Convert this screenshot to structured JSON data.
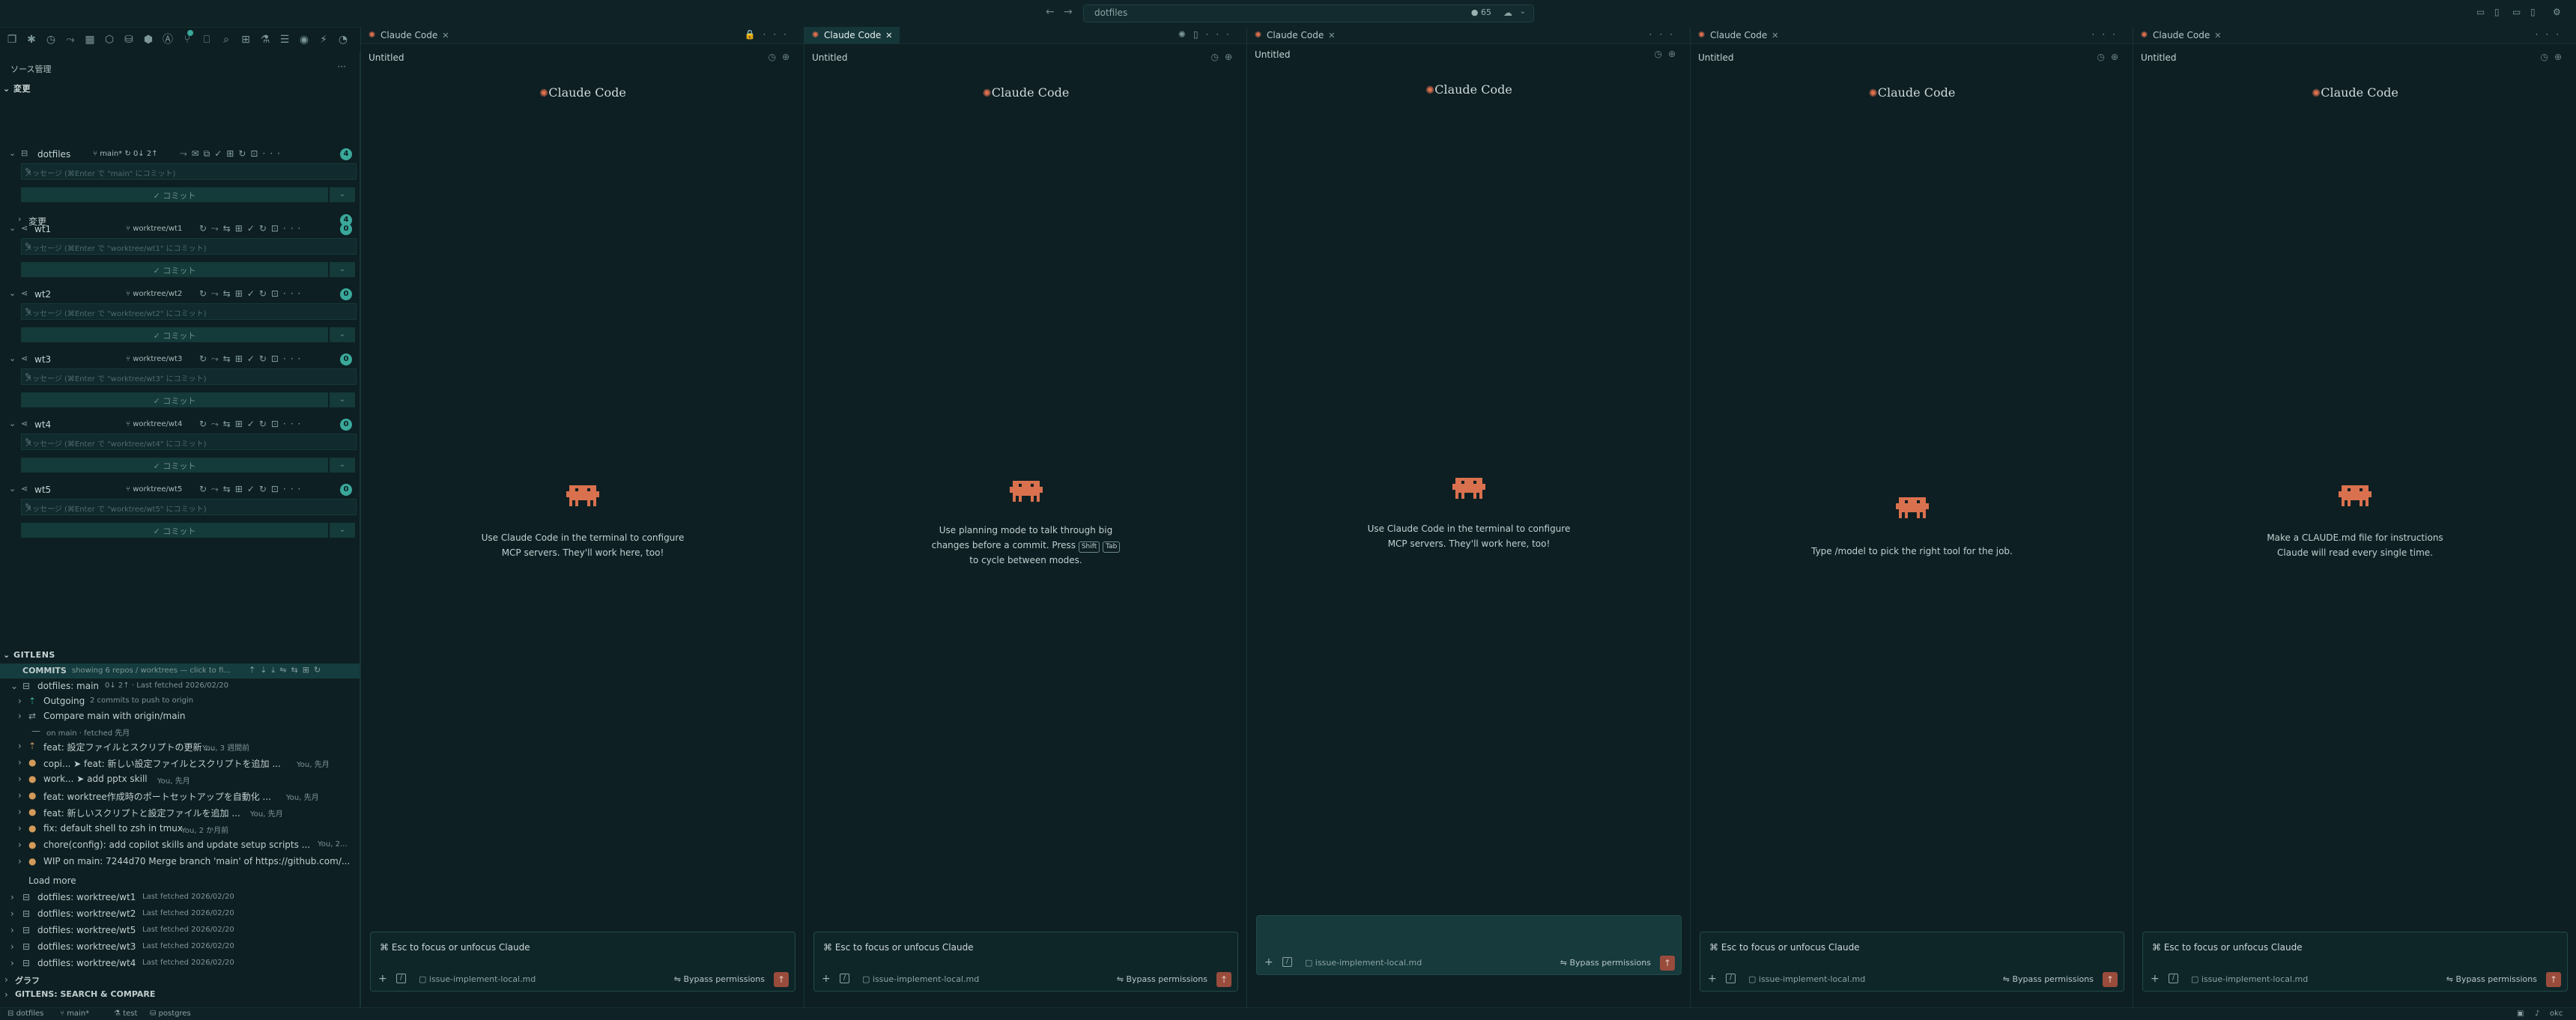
{
  "title_bar": {
    "search_text": "dotfiles",
    "badge_count": "65"
  },
  "sidebar": {
    "header": "ソース管理",
    "changes_section": "変更",
    "repos": [
      {
        "name": "dotfiles",
        "branch": "main*",
        "sync": "0↓ 2↑",
        "message_placeholder": "メッセージ (⌘Enter で \"main\" にコミット)",
        "commit_label": "✓ コミット",
        "count": "4"
      },
      {
        "name": "wt1",
        "branch": "worktree/wt1",
        "message_placeholder": "メッセージ (⌘Enter で \"worktree/wt1\" にコミット)",
        "commit_label": "✓ コミット",
        "count": "0"
      },
      {
        "name": "wt2",
        "branch": "worktree/wt2",
        "message_placeholder": "メッセージ (⌘Enter で \"worktree/wt2\" にコミット)",
        "commit_label": "✓ コミット",
        "count": "0"
      },
      {
        "name": "wt3",
        "branch": "worktree/wt3",
        "message_placeholder": "メッセージ (⌘Enter で \"worktree/wt3\" にコミット)",
        "commit_label": "✓ コミット",
        "count": "0"
      },
      {
        "name": "wt4",
        "branch": "worktree/wt4",
        "message_placeholder": "メッセージ (⌘Enter で \"worktree/wt4\" にコミット)",
        "commit_label": "✓ コミット",
        "count": "0"
      },
      {
        "name": "wt5",
        "branch": "worktree/wt5",
        "message_placeholder": "メッセージ (⌘Enter で \"worktree/wt5\" にコミット)",
        "commit_label": "✓ コミット",
        "count": "0"
      }
    ],
    "changes_row": {
      "label": "変更",
      "count": "4"
    },
    "gitlens": {
      "header": "GITLENS",
      "commits_label": "COMMITS",
      "commits_sub": "showing 6 repos / worktrees — click to fi...",
      "repo_main": "dotfiles: main",
      "repo_main_sub": "0↓ 2↑ · Last fetched 2026/02/20",
      "outgoing": "Outgoing",
      "outgoing_sub": "2 commits to push to origin",
      "compare": "Compare main with origin/main",
      "on_main": "on main · fetched 先月",
      "commits": [
        {
          "msg": "feat: 設定ファイルとスクリプトの更新 ...",
          "meta": "You, 3 週間前"
        },
        {
          "msg": "copi... ➤ feat: 新しい設定ファイルとスクリプトを追加 ...",
          "meta": "You, 先月"
        },
        {
          "msg": "work... ➤ add pptx skill",
          "meta": "You, 先月"
        },
        {
          "msg": "feat: worktree作成時のポートセットアップを自動化 ...",
          "meta": "You, 先月"
        },
        {
          "msg": "feat: 新しいスクリプトと設定ファイルを追加 ...",
          "meta": "You, 先月"
        },
        {
          "msg": "fix: default shell to zsh in tmux",
          "meta": "You, 2 か月前"
        },
        {
          "msg": "chore(config): add copilot skills and update setup scripts ...",
          "meta": "You, 2..."
        },
        {
          "msg": "WIP on main: 7244d70 Merge branch 'main' of https://github.com/...",
          "meta": ""
        }
      ],
      "load_more": "Load more",
      "worktrees": [
        {
          "name": "dotfiles: worktree/wt1",
          "sub": "Last fetched 2026/02/20"
        },
        {
          "name": "dotfiles: worktree/wt2",
          "sub": "Last fetched 2026/02/20"
        },
        {
          "name": "dotfiles: worktree/wt5",
          "sub": "Last fetched 2026/02/20"
        },
        {
          "name": "dotfiles: worktree/wt3",
          "sub": "Last fetched 2026/02/20"
        },
        {
          "name": "dotfiles: worktree/wt4",
          "sub": "Last fetched 2026/02/20"
        }
      ],
      "graph": "グラフ",
      "search_compare": "GITLENS: SEARCH & COMPARE"
    }
  },
  "editor_groups": [
    {
      "tab": "Claude Code",
      "subtitle": "Untitled",
      "brand": "Claude Code",
      "tip_lines": [
        "Use Claude Code in the terminal to configure",
        "MCP servers. They'll work here, too!"
      ],
      "input_placeholder": "⌘ Esc to focus or unfocus Claude",
      "file": "issue-implement-local.md",
      "bypass": "Bypass permissions"
    },
    {
      "tab": "Claude Code",
      "subtitle": "Untitled",
      "brand": "Claude Code",
      "tip_lines": [
        "Use planning mode to talk through big",
        "changes before a commit. Press",
        "to cycle between modes."
      ],
      "kbd": [
        "Shift",
        "Tab"
      ],
      "input_placeholder": "⌘ Esc to focus or unfocus Claude",
      "file": "issue-implement-local.md",
      "bypass": "Bypass permissions"
    },
    {
      "tab": "Claude Code",
      "subtitle": "Untitled",
      "brand": "Claude Code",
      "tip_lines": [
        "Use Claude Code in the terminal to configure",
        "MCP servers. They'll work here, too!"
      ],
      "input_placeholder": "",
      "file": "issue-implement-local.md",
      "bypass": "Bypass permissions"
    },
    {
      "tab": "Claude Code",
      "subtitle": "Untitled",
      "brand": "Claude Code",
      "tip_lines": [
        "Type /model to pick the right tool for the job."
      ],
      "input_placeholder": "⌘ Esc to focus or unfocus Claude",
      "file": "issue-implement-local.md",
      "bypass": "Bypass permissions"
    },
    {
      "tab": "Claude Code",
      "subtitle": "Untitled",
      "brand": "Claude Code",
      "tip_lines": [
        "Make a CLAUDE.md file for instructions",
        "Claude will read every single time."
      ],
      "input_placeholder": "⌘ Esc to focus or unfocus Claude",
      "file": "issue-implement-local.md",
      "bypass": "Bypass permissions"
    }
  ],
  "status_bar": {
    "repo": "dotfiles",
    "branch": "main*",
    "test": "test",
    "db": "postgres",
    "right": "okc"
  },
  "colors": {
    "background": "#0d1f22",
    "accent": "#3aa89a",
    "claude": "#e0704f"
  }
}
